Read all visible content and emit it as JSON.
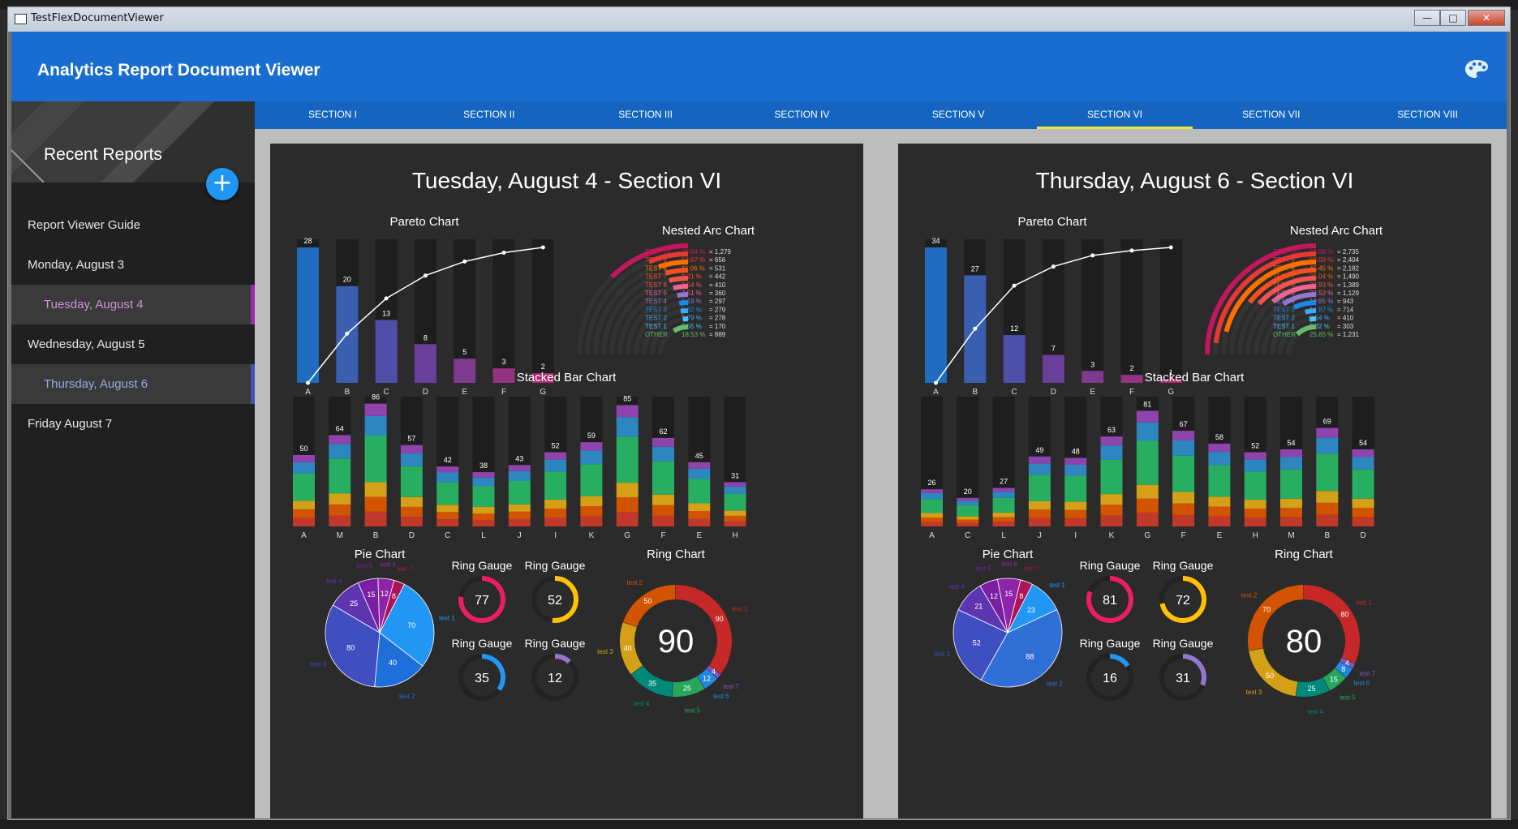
{
  "window": {
    "title": "TestFlexDocumentViewer",
    "min": "—",
    "max": "□",
    "close": "✕"
  },
  "app": {
    "title": "Analytics Report Document Viewer",
    "palette_icon": "palette-icon"
  },
  "sidebar": {
    "header": "Recent Reports",
    "add_icon": "plus-icon",
    "items": [
      {
        "label": "Report Viewer Guide",
        "selected": false,
        "accent": ""
      },
      {
        "label": "Monday, August 3",
        "selected": false,
        "accent": ""
      },
      {
        "label": "Tuesday, August 4",
        "selected": true,
        "accent": "#9c27b0",
        "text_color": "#ce93d8"
      },
      {
        "label": "Wednesday, August 5",
        "selected": false,
        "accent": ""
      },
      {
        "label": "Thursday, August 6",
        "selected": true,
        "accent": "#3f51b5",
        "text_color": "#9fa8da"
      },
      {
        "label": "Friday August 7",
        "selected": false,
        "accent": ""
      }
    ]
  },
  "tabs": [
    "SECTION I",
    "SECTION II",
    "SECTION III",
    "SECTION IV",
    "SECTION V",
    "SECTION VI",
    "SECTION VII",
    "SECTION VIII"
  ],
  "active_tab": 5,
  "colors": {
    "test10": "#c2185b",
    "test9": "#e53935",
    "test8": "#ff6f00",
    "test7": "#f4511e",
    "test6": "#ef5350",
    "test5": "#f06292",
    "test4": "#9575cd",
    "test3": "#1e88e5",
    "test2": "#42a5f5",
    "test1": "#4fc3f7",
    "other": "#66bb6a"
  },
  "reports": [
    {
      "title": "Tuesday, August 4 - Section VI",
      "pareto": {
        "title": "Pareto Chart",
        "categories": [
          "A",
          "B",
          "C",
          "D",
          "E",
          "F",
          "G"
        ],
        "values": [
          28,
          20,
          13,
          8,
          5,
          3,
          2
        ],
        "colors": [
          "#1e6bbf",
          "#3a5fb0",
          "#4d4fa8",
          "#6a3f9a",
          "#7e3a8e",
          "#943380",
          "#a82b72"
        ]
      },
      "nested_arc": {
        "title": "Nested Arc Chart",
        "items": [
          {
            "label": "TEST 10",
            "pct": "26.64 %",
            "val": "= 1,279",
            "frac": 0.2664,
            "color": "#c2185b"
          },
          {
            "label": "TEST 9",
            "pct": "13.67 %",
            "val": "= 656",
            "frac": 0.1367,
            "color": "#e53935"
          },
          {
            "label": "TEST 8",
            "pct": "11.06 %",
            "val": "= 531",
            "frac": 0.1106,
            "color": "#ff6f00"
          },
          {
            "label": "TEST 7",
            "pct": "9.21 %",
            "val": "= 442",
            "frac": 0.0921,
            "color": "#f4511e"
          },
          {
            "label": "TEST 6",
            "pct": "8.54 %",
            "val": "= 410",
            "frac": 0.0854,
            "color": "#ef5350"
          },
          {
            "label": "TEST 5",
            "pct": "7.51 %",
            "val": "= 360",
            "frac": 0.0751,
            "color": "#f06292"
          },
          {
            "label": "TEST 4",
            "pct": "6.19 %",
            "val": "= 297",
            "frac": 0.0619,
            "color": "#9575cd"
          },
          {
            "label": "TEST 3",
            "pct": "5.82 %",
            "val": "= 279",
            "frac": 0.0582,
            "color": "#1e88e5"
          },
          {
            "label": "TEST 2",
            "pct": "5.79 %",
            "val": "= 278",
            "frac": 0.0579,
            "color": "#42a5f5"
          },
          {
            "label": "TEST 1",
            "pct": "3.55 %",
            "val": "= 170",
            "frac": 0.0355,
            "color": "#4fc3f7"
          },
          {
            "label": "OTHER",
            "pct": "18.53 %",
            "val": "= 889",
            "frac": 0.1853,
            "color": "#66bb6a"
          }
        ]
      },
      "stacked": {
        "title": "Stacked Bar Chart",
        "categories": [
          "A",
          "M",
          "B",
          "D",
          "C",
          "L",
          "J",
          "I",
          "K",
          "G",
          "F",
          "E",
          "H"
        ],
        "totals": [
          50,
          64,
          86,
          57,
          42,
          38,
          43,
          52,
          59,
          85,
          62,
          45,
          31
        ]
      },
      "pie": {
        "title": "Pie Chart",
        "slices": [
          {
            "label": "test 1",
            "value": 70,
            "color": "#2196f3"
          },
          {
            "label": "test 2",
            "value": 40,
            "color": "#1e6fd9"
          },
          {
            "label": "test 3",
            "value": 80,
            "color": "#3f4fbf"
          },
          {
            "label": "test 4",
            "value": 25,
            "color": "#5e35b1"
          },
          {
            "label": "test 5",
            "value": 15,
            "color": "#7b1fa2"
          },
          {
            "label": "test 6",
            "value": 12,
            "color": "#8e24aa"
          },
          {
            "label": "test 7",
            "value": 8,
            "color": "#ad1457"
          }
        ]
      },
      "gauges": [
        {
          "title": "Ring Gauge",
          "value": 77,
          "color": "#e91e63"
        },
        {
          "title": "Ring Gauge",
          "value": 52,
          "color": "#ffc107"
        },
        {
          "title": "Ring Gauge",
          "value": 35,
          "color": "#2196f3"
        },
        {
          "title": "Ring Gauge",
          "value": 12,
          "color": "#9575cd"
        }
      ],
      "ring": {
        "title": "Ring Chart",
        "center": "90",
        "slices": [
          {
            "label": "test 1",
            "value": 90,
            "color": "#c62828"
          },
          {
            "label": "test 7",
            "value": 4,
            "color": "#7e57c2"
          },
          {
            "label": "test 6",
            "value": 12,
            "color": "#1e88e5"
          },
          {
            "label": "test 5",
            "value": 25,
            "color": "#26a65b"
          },
          {
            "label": "test 4",
            "value": 35,
            "color": "#00897b"
          },
          {
            "label": "test 3",
            "value": 40,
            "color": "#d4a017"
          },
          {
            "label": "test 2",
            "value": 50,
            "color": "#d35400"
          }
        ]
      }
    },
    {
      "title": "Thursday, August 6 - Section VI",
      "pareto": {
        "title": "Pareto Chart",
        "categories": [
          "A",
          "B",
          "C",
          "D",
          "E",
          "F",
          "G"
        ],
        "values": [
          34,
          27,
          12,
          7,
          3,
          2,
          1
        ],
        "colors": [
          "#1e6bbf",
          "#3a5fb0",
          "#4d4fa8",
          "#6a3f9a",
          "#7e3a8e",
          "#943380",
          "#a82b72"
        ]
      },
      "nested_arc": {
        "title": "Nested Arc Chart",
        "items": [
          {
            "label": "TEST 10",
            "pct": "56.98 %",
            "val": "= 2,735",
            "frac": 0.5698,
            "color": "#c2185b"
          },
          {
            "label": "TEST 9",
            "pct": "50.09 %",
            "val": "= 2,404",
            "frac": 0.5009,
            "color": "#e53935"
          },
          {
            "label": "TEST 8",
            "pct": "45.45 %",
            "val": "= 2,182",
            "frac": 0.4545,
            "color": "#ff6f00"
          },
          {
            "label": "TEST 7",
            "pct": "31.04 %",
            "val": "= 1,490",
            "frac": 0.3104,
            "color": "#f4511e"
          },
          {
            "label": "TEST 6",
            "pct": "28.93 %",
            "val": "= 1,389",
            "frac": 0.2893,
            "color": "#ef5350"
          },
          {
            "label": "TEST 5",
            "pct": "23.52 %",
            "val": "= 1,129",
            "frac": 0.2352,
            "color": "#f06292"
          },
          {
            "label": "TEST 4",
            "pct": "19.65 %",
            "val": "= 943",
            "frac": 0.1965,
            "color": "#9575cd"
          },
          {
            "label": "TEST 3",
            "pct": "14.87 %",
            "val": "= 714",
            "frac": 0.1487,
            "color": "#1e88e5"
          },
          {
            "label": "TEST 2",
            "pct": "8.54 %",
            "val": "= 410",
            "frac": 0.0854,
            "color": "#42a5f5"
          },
          {
            "label": "TEST 1",
            "pct": "6.32 %",
            "val": "= 303",
            "frac": 0.0632,
            "color": "#4fc3f7"
          },
          {
            "label": "OTHER",
            "pct": "25.65 %",
            "val": "= 1,231",
            "frac": 0.2565,
            "color": "#66bb6a"
          }
        ]
      },
      "stacked": {
        "title": "Stacked Bar Chart",
        "categories": [
          "A",
          "C",
          "L",
          "J",
          "I",
          "K",
          "G",
          "F",
          "E",
          "H",
          "M",
          "B",
          "D"
        ],
        "totals": [
          26,
          20,
          27,
          49,
          48,
          63,
          81,
          67,
          58,
          52,
          54,
          69,
          54
        ]
      },
      "pie": {
        "title": "Pie Chart",
        "slices": [
          {
            "label": "test 1",
            "value": 23,
            "color": "#2196f3"
          },
          {
            "label": "test 2",
            "value": 88,
            "color": "#2f6fd6"
          },
          {
            "label": "test 3",
            "value": 52,
            "color": "#3f4fbf"
          },
          {
            "label": "test 4",
            "value": 21,
            "color": "#5e35b1"
          },
          {
            "label": "test 5",
            "value": 12,
            "color": "#7b1fa2"
          },
          {
            "label": "test 6",
            "value": 15,
            "color": "#8e24aa"
          },
          {
            "label": "test 7",
            "value": 8,
            "color": "#ad1457"
          }
        ]
      },
      "gauges": [
        {
          "title": "Ring Gauge",
          "value": 81,
          "color": "#e91e63"
        },
        {
          "title": "Ring Gauge",
          "value": 72,
          "color": "#ffc107"
        },
        {
          "title": "Ring Gauge",
          "value": 16,
          "color": "#2196f3"
        },
        {
          "title": "Ring Gauge",
          "value": 31,
          "color": "#9575cd"
        }
      ],
      "ring": {
        "title": "Ring Chart",
        "center": "80",
        "slices": [
          {
            "label": "test 1",
            "value": 80,
            "color": "#c62828"
          },
          {
            "label": "test 7",
            "value": 4,
            "color": "#7e57c2"
          },
          {
            "label": "test 6",
            "value": 8,
            "color": "#1e88e5"
          },
          {
            "label": "test 5",
            "value": 15,
            "color": "#26a65b"
          },
          {
            "label": "test 4",
            "value": 25,
            "color": "#00897b"
          },
          {
            "label": "test 3",
            "value": 50,
            "color": "#d4a017"
          },
          {
            "label": "test 2",
            "value": 70,
            "color": "#d35400"
          }
        ]
      }
    }
  ],
  "chart_data": [
    {
      "type": "bar",
      "title": "Pareto Chart",
      "categories": [
        "A",
        "B",
        "C",
        "D",
        "E",
        "F",
        "G"
      ],
      "values": [
        28,
        20,
        13,
        8,
        5,
        3,
        2
      ]
    },
    {
      "type": "bar",
      "title": "Stacked Bar Chart",
      "categories": [
        "A",
        "M",
        "B",
        "D",
        "C",
        "L",
        "J",
        "I",
        "K",
        "G",
        "F",
        "E",
        "H"
      ],
      "values": [
        50,
        64,
        86,
        57,
        42,
        38,
        43,
        52,
        59,
        85,
        62,
        45,
        31
      ]
    },
    {
      "type": "pie",
      "title": "Pie Chart",
      "categories": [
        "test 1",
        "test 2",
        "test 3",
        "test 4",
        "test 5",
        "test 6",
        "test 7"
      ],
      "values": [
        70,
        40,
        80,
        25,
        15,
        12,
        8
      ]
    },
    {
      "type": "pie",
      "title": "Ring Chart",
      "categories": [
        "test 1",
        "test 2",
        "test 3",
        "test 4",
        "test 5",
        "test 6",
        "test 7"
      ],
      "values": [
        90,
        50,
        40,
        35,
        25,
        12,
        4
      ]
    },
    {
      "type": "bar",
      "title": "Pareto Chart",
      "categories": [
        "A",
        "B",
        "C",
        "D",
        "E",
        "F",
        "G"
      ],
      "values": [
        34,
        27,
        12,
        7,
        3,
        2,
        1
      ]
    },
    {
      "type": "bar",
      "title": "Stacked Bar Chart",
      "categories": [
        "A",
        "C",
        "L",
        "J",
        "I",
        "K",
        "G",
        "F",
        "E",
        "H",
        "M",
        "B",
        "D"
      ],
      "values": [
        26,
        20,
        27,
        49,
        48,
        63,
        81,
        67,
        58,
        52,
        54,
        69,
        54
      ]
    },
    {
      "type": "pie",
      "title": "Pie Chart",
      "categories": [
        "test 1",
        "test 2",
        "test 3",
        "test 4",
        "test 5",
        "test 6",
        "test 7"
      ],
      "values": [
        23,
        88,
        52,
        21,
        12,
        15,
        8
      ]
    },
    {
      "type": "pie",
      "title": "Ring Chart",
      "categories": [
        "test 1",
        "test 2",
        "test 3",
        "test 4",
        "test 5",
        "test 6",
        "test 7"
      ],
      "values": [
        80,
        70,
        50,
        25,
        15,
        8,
        4
      ]
    }
  ]
}
